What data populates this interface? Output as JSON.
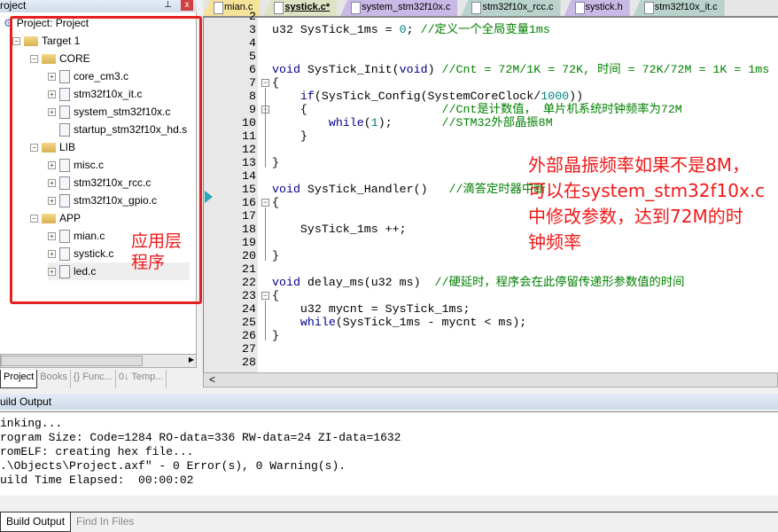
{
  "project_panel": {
    "title": "roject",
    "close": "x",
    "pin": "⊥"
  },
  "tree": [
    {
      "label": "Project: Project",
      "level": 0,
      "type": "root"
    },
    {
      "label": "Target 1",
      "level": 1,
      "type": "target",
      "expand": "−"
    },
    {
      "label": "CORE",
      "level": 2,
      "type": "folder",
      "expand": "−"
    },
    {
      "label": "core_cm3.c",
      "level": 3,
      "type": "file",
      "expand": "+"
    },
    {
      "label": "stm32f10x_it.c",
      "level": 3,
      "type": "file",
      "expand": "+"
    },
    {
      "label": "system_stm32f10x.c",
      "level": 3,
      "type": "file",
      "expand": "+"
    },
    {
      "label": "startup_stm32f10x_hd.s",
      "level": 3,
      "type": "file",
      "expand": ""
    },
    {
      "label": "LIB",
      "level": 2,
      "type": "folder",
      "expand": "−"
    },
    {
      "label": "misc.c",
      "level": 3,
      "type": "file",
      "expand": "+"
    },
    {
      "label": "stm32f10x_rcc.c",
      "level": 3,
      "type": "file",
      "expand": "+"
    },
    {
      "label": "stm32f10x_gpio.c",
      "level": 3,
      "type": "file",
      "expand": "+"
    },
    {
      "label": "APP",
      "level": 2,
      "type": "folder",
      "expand": "−"
    },
    {
      "label": "mian.c",
      "level": 3,
      "type": "file",
      "expand": "+"
    },
    {
      "label": "systick.c",
      "level": 3,
      "type": "file",
      "expand": "+"
    },
    {
      "label": "led.c",
      "level": 3,
      "type": "file",
      "expand": "+"
    }
  ],
  "annotation_left": [
    "应用层",
    "程序"
  ],
  "annotation_right": [
    "外部晶振频率如果不是8M，",
    "可以在system_stm32f10x.c",
    "中修改参数，达到72M的时",
    "钟频率"
  ],
  "left_tabs": [
    {
      "label": "Project",
      "active": true
    },
    {
      "label": "Books"
    },
    {
      "label": "{} Func..."
    },
    {
      "label": "0↓ Temp..."
    }
  ],
  "editor_tabs": [
    {
      "label": "mian.c",
      "color": "#f6e39a"
    },
    {
      "label": "systick.c*",
      "color": "#dfe3c4",
      "active": true
    },
    {
      "label": "system_stm32f10x.c",
      "color": "#c9b9e6"
    },
    {
      "label": "stm32f10x_rcc.c",
      "color": "#b9d3cc"
    },
    {
      "label": "systick.h",
      "color": "#c9b9e6"
    },
    {
      "label": "stm32f10x_it.c",
      "color": "#b9d3cc"
    }
  ],
  "code": [
    {
      "n": "2",
      "s": []
    },
    {
      "n": "3",
      "s": [
        [
          "u32 SysTick_1ms = ",
          ""
        ],
        [
          "0",
          "num"
        ],
        [
          "; ",
          ""
        ],
        [
          "//定义一个全局变量1ms",
          "cm"
        ]
      ]
    },
    {
      "n": "4",
      "s": []
    },
    {
      "n": "5",
      "s": []
    },
    {
      "n": "6",
      "s": [
        [
          "void",
          "kw"
        ],
        [
          " SysTick_Init(",
          ""
        ],
        [
          "void",
          "kw"
        ],
        [
          ") ",
          ""
        ],
        [
          "//Cnt = 72M/1K = 72K, 时间 = 72K/72M = 1K = 1ms",
          "cm"
        ]
      ]
    },
    {
      "n": "7",
      "s": [
        [
          "{",
          ""
        ]
      ],
      "fold": "−"
    },
    {
      "n": "8",
      "s": [
        [
          "    ",
          ""
        ],
        [
          "if",
          "kw"
        ],
        [
          "(SysTick_Config(SystemCoreClock/",
          ""
        ],
        [
          "1000",
          "num"
        ],
        [
          "))",
          ""
        ]
      ]
    },
    {
      "n": "9",
      "s": [
        [
          "    {                   ",
          ""
        ],
        [
          "//Cnt是计数值， 单片机系统时钟频率为72M",
          "cm"
        ]
      ],
      "fold": "−"
    },
    {
      "n": "10",
      "s": [
        [
          "        ",
          ""
        ],
        [
          "while",
          "kw"
        ],
        [
          "(",
          ""
        ],
        [
          "1",
          "num"
        ],
        [
          ");       ",
          ""
        ],
        [
          "//STM32外部晶振8M",
          "cm"
        ]
      ]
    },
    {
      "n": "11",
      "s": [
        [
          "    }",
          ""
        ]
      ]
    },
    {
      "n": "12",
      "s": []
    },
    {
      "n": "13",
      "s": [
        [
          "}",
          ""
        ]
      ]
    },
    {
      "n": "14",
      "s": []
    },
    {
      "n": "15",
      "s": [
        [
          "void",
          "kw"
        ],
        [
          " SysTick_Handler()   ",
          ""
        ],
        [
          "//滴答定时器中断",
          "cm"
        ]
      ]
    },
    {
      "n": "16",
      "s": [
        [
          "{",
          ""
        ]
      ],
      "fold": "−"
    },
    {
      "n": "17",
      "s": []
    },
    {
      "n": "18",
      "s": [
        [
          "    SysTick_1ms ++;",
          ""
        ]
      ]
    },
    {
      "n": "19",
      "s": []
    },
    {
      "n": "20",
      "s": [
        [
          "}",
          ""
        ]
      ]
    },
    {
      "n": "21",
      "s": []
    },
    {
      "n": "22",
      "s": [
        [
          "void",
          "kw"
        ],
        [
          " delay_ms(u32 ms)  ",
          ""
        ],
        [
          "//硬延时，程序会在此停留传递形参数值的时间",
          "cm"
        ]
      ]
    },
    {
      "n": "23",
      "s": [
        [
          "{",
          ""
        ]
      ],
      "fold": "−"
    },
    {
      "n": "24",
      "s": [
        [
          "    u32 mycnt = SysTick_1ms;",
          ""
        ]
      ]
    },
    {
      "n": "25",
      "s": [
        [
          "    ",
          ""
        ],
        [
          "while",
          "kw"
        ],
        [
          "(SysTick_1ms - mycnt < ms);",
          ""
        ]
      ]
    },
    {
      "n": "26",
      "s": [
        [
          "}",
          ""
        ]
      ]
    },
    {
      "n": "27",
      "s": []
    },
    {
      "n": "28",
      "s": []
    }
  ],
  "build_output": {
    "title": "uild Output",
    "lines": [
      "inking...",
      "rogram Size: Code=1284 RO-data=336 RW-data=24 ZI-data=1632",
      "romELF: creating hex file...",
      ".\\Objects\\Project.axf\" - 0 Error(s), 0 Warning(s).",
      "uild Time Elapsed:  00:00:02"
    ]
  },
  "bottom_tabs": [
    {
      "label": "Build Output",
      "active": true
    },
    {
      "label": "Find In Files"
    }
  ]
}
